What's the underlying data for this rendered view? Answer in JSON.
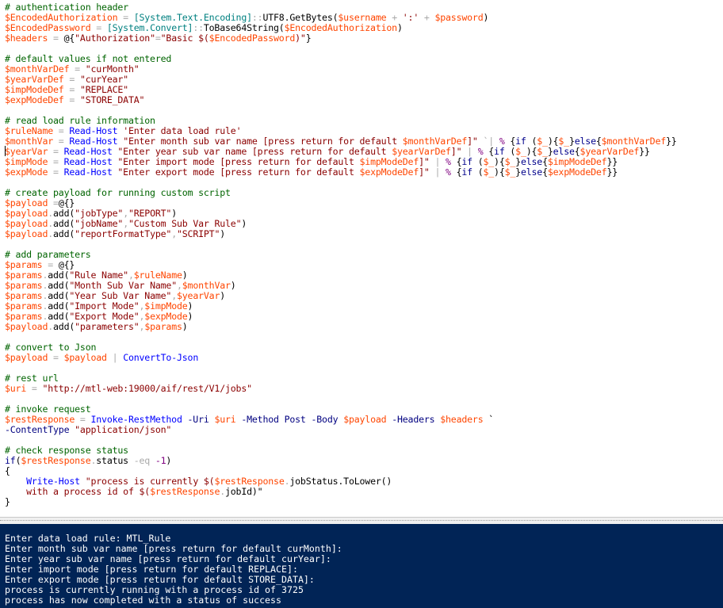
{
  "colors": {
    "editor_background": "#ffffff",
    "console_background": "#012456",
    "console_text": "#ffffff",
    "comment": "#006400",
    "variable": "#ff4500",
    "operator": "#a9a9a9",
    "string": "#8b0000",
    "command": "#0000ff",
    "type": "#008080",
    "parameter": "#000080"
  },
  "script": [
    [
      [
        "comment",
        "# authentication header"
      ]
    ],
    [
      [
        "var",
        "$EncodedAuthorization"
      ],
      [
        "op",
        " = "
      ],
      [
        "type",
        "[System.Text.Encoding]"
      ],
      [
        "op",
        "::"
      ],
      [
        "plain",
        "UTF8.GetBytes("
      ],
      [
        "var",
        "$username"
      ],
      [
        "op",
        " + "
      ],
      [
        "str",
        "':'"
      ],
      [
        "op",
        " + "
      ],
      [
        "var",
        "$password"
      ],
      [
        "plain",
        ")"
      ]
    ],
    [
      [
        "var",
        "$EncodedPassword"
      ],
      [
        "op",
        " = "
      ],
      [
        "type",
        "[System.Convert]"
      ],
      [
        "op",
        "::"
      ],
      [
        "plain",
        "ToBase64String("
      ],
      [
        "var",
        "$EncodedAuthorization"
      ],
      [
        "plain",
        ")"
      ]
    ],
    [
      [
        "var",
        "$headers"
      ],
      [
        "op",
        " = "
      ],
      [
        "plain",
        "@{"
      ],
      [
        "str",
        "\"Authorization\""
      ],
      [
        "op",
        "="
      ],
      [
        "str",
        "\"Basic $("
      ],
      [
        "var",
        "$EncodedPassword"
      ],
      [
        "str",
        ")\""
      ],
      [
        "plain",
        "}"
      ]
    ],
    [],
    [
      [
        "comment",
        "# default values if not entered"
      ]
    ],
    [
      [
        "var",
        "$monthVarDef"
      ],
      [
        "op",
        " = "
      ],
      [
        "str",
        "\"curMonth\""
      ]
    ],
    [
      [
        "var",
        "$yearVarDef"
      ],
      [
        "op",
        " = "
      ],
      [
        "str",
        "\"curYear\""
      ]
    ],
    [
      [
        "var",
        "$impModeDef"
      ],
      [
        "op",
        " = "
      ],
      [
        "str",
        "\"REPLACE\""
      ]
    ],
    [
      [
        "var",
        "$expModeDef"
      ],
      [
        "op",
        " = "
      ],
      [
        "str",
        "\"STORE_DATA\""
      ]
    ],
    [],
    [
      [
        "comment",
        "# read load rule information"
      ]
    ],
    [
      [
        "var",
        "$ruleName"
      ],
      [
        "op",
        " = "
      ],
      [
        "cmd",
        "Read-Host"
      ],
      [
        "plain",
        " "
      ],
      [
        "str",
        "'Enter data load rule'"
      ]
    ],
    [
      [
        "var",
        "$monthVar"
      ],
      [
        "op",
        " = "
      ],
      [
        "cmd",
        "Read-Host"
      ],
      [
        "plain",
        " "
      ],
      [
        "str",
        "\"Enter month sub var name [press return for default "
      ],
      [
        "var",
        "$monthVarDef"
      ],
      [
        "str",
        "]\""
      ],
      [
        "plain",
        " "
      ],
      [
        "op",
        "`|"
      ],
      [
        "plain",
        " "
      ],
      [
        "num",
        "%"
      ],
      [
        "plain",
        " {"
      ],
      [
        "kw",
        "if"
      ],
      [
        "plain",
        " ("
      ],
      [
        "var",
        "$_"
      ],
      [
        "plain",
        "){"
      ],
      [
        "var",
        "$_"
      ],
      [
        "plain",
        "}"
      ],
      [
        "kw",
        "else"
      ],
      [
        "plain",
        "{"
      ],
      [
        "var",
        "$monthVarDef"
      ],
      [
        "plain",
        "}}"
      ]
    ],
    [
      [
        "var",
        "$yearVar"
      ],
      [
        "op",
        " = "
      ],
      [
        "cmd",
        "Read-Host"
      ],
      [
        "plain",
        " "
      ],
      [
        "str",
        "\"Enter year sub var name [press return for default "
      ],
      [
        "var",
        "$yearVarDef"
      ],
      [
        "str",
        "]\""
      ],
      [
        "plain",
        " "
      ],
      [
        "op",
        "|"
      ],
      [
        "plain",
        " "
      ],
      [
        "num",
        "%"
      ],
      [
        "plain",
        " {"
      ],
      [
        "kw",
        "if"
      ],
      [
        "plain",
        " ("
      ],
      [
        "var",
        "$_"
      ],
      [
        "plain",
        "){"
      ],
      [
        "var",
        "$_"
      ],
      [
        "plain",
        "}"
      ],
      [
        "kw",
        "else"
      ],
      [
        "plain",
        "{"
      ],
      [
        "var",
        "$yearVarDef"
      ],
      [
        "plain",
        "}}"
      ]
    ],
    [
      [
        "var",
        "$impMode"
      ],
      [
        "op",
        " = "
      ],
      [
        "cmd",
        "Read-Host"
      ],
      [
        "plain",
        " "
      ],
      [
        "str",
        "\"Enter import mode [press return for default "
      ],
      [
        "var",
        "$impModeDef"
      ],
      [
        "str",
        "]\""
      ],
      [
        "plain",
        " "
      ],
      [
        "op",
        "|"
      ],
      [
        "plain",
        " "
      ],
      [
        "num",
        "%"
      ],
      [
        "plain",
        " {"
      ],
      [
        "kw",
        "if"
      ],
      [
        "plain",
        " ("
      ],
      [
        "var",
        "$_"
      ],
      [
        "plain",
        "){"
      ],
      [
        "var",
        "$_"
      ],
      [
        "plain",
        "}"
      ],
      [
        "kw",
        "else"
      ],
      [
        "plain",
        "{"
      ],
      [
        "var",
        "$impModeDef"
      ],
      [
        "plain",
        "}}"
      ]
    ],
    [
      [
        "var",
        "$expMode"
      ],
      [
        "op",
        " = "
      ],
      [
        "cmd",
        "Read-Host"
      ],
      [
        "plain",
        " "
      ],
      [
        "str",
        "\"Enter export mode [press return for default "
      ],
      [
        "var",
        "$expModeDef"
      ],
      [
        "str",
        "]\""
      ],
      [
        "plain",
        " "
      ],
      [
        "op",
        "|"
      ],
      [
        "plain",
        " "
      ],
      [
        "num",
        "%"
      ],
      [
        "plain",
        " {"
      ],
      [
        "kw",
        "if"
      ],
      [
        "plain",
        " ("
      ],
      [
        "var",
        "$_"
      ],
      [
        "plain",
        "){"
      ],
      [
        "var",
        "$_"
      ],
      [
        "plain",
        "}"
      ],
      [
        "kw",
        "else"
      ],
      [
        "plain",
        "{"
      ],
      [
        "var",
        "$expModeDef"
      ],
      [
        "plain",
        "}}"
      ]
    ],
    [],
    [
      [
        "comment",
        "# create payload for running custom script"
      ]
    ],
    [
      [
        "var",
        "$payload"
      ],
      [
        "op",
        " ="
      ],
      [
        "plain",
        "@{}"
      ]
    ],
    [
      [
        "var",
        "$payload"
      ],
      [
        "op",
        "."
      ],
      [
        "plain",
        "add("
      ],
      [
        "str",
        "\"jobType\""
      ],
      [
        "op",
        ","
      ],
      [
        "str",
        "\"REPORT\""
      ],
      [
        "plain",
        ")"
      ]
    ],
    [
      [
        "var",
        "$payload"
      ],
      [
        "op",
        "."
      ],
      [
        "plain",
        "add("
      ],
      [
        "str",
        "\"jobName\""
      ],
      [
        "op",
        ","
      ],
      [
        "str",
        "\"Custom Sub Var Rule\""
      ],
      [
        "plain",
        ")"
      ]
    ],
    [
      [
        "var",
        "$payload"
      ],
      [
        "op",
        "."
      ],
      [
        "plain",
        "add("
      ],
      [
        "str",
        "\"reportFormatType\""
      ],
      [
        "op",
        ","
      ],
      [
        "str",
        "\"SCRIPT\""
      ],
      [
        "plain",
        ")"
      ]
    ],
    [],
    [
      [
        "comment",
        "# add parameters"
      ]
    ],
    [
      [
        "var",
        "$params"
      ],
      [
        "op",
        " = "
      ],
      [
        "plain",
        "@{}"
      ]
    ],
    [
      [
        "var",
        "$params"
      ],
      [
        "op",
        "."
      ],
      [
        "plain",
        "add("
      ],
      [
        "str",
        "\"Rule Name\""
      ],
      [
        "op",
        ","
      ],
      [
        "var",
        "$ruleName"
      ],
      [
        "plain",
        ")"
      ]
    ],
    [
      [
        "var",
        "$params"
      ],
      [
        "op",
        "."
      ],
      [
        "plain",
        "add("
      ],
      [
        "str",
        "\"Month Sub Var Name\""
      ],
      [
        "op",
        ","
      ],
      [
        "var",
        "$monthVar"
      ],
      [
        "plain",
        ")"
      ]
    ],
    [
      [
        "var",
        "$params"
      ],
      [
        "op",
        "."
      ],
      [
        "plain",
        "add("
      ],
      [
        "str",
        "\"Year Sub Var Name\""
      ],
      [
        "op",
        ","
      ],
      [
        "var",
        "$yearVar"
      ],
      [
        "plain",
        ")"
      ]
    ],
    [
      [
        "var",
        "$params"
      ],
      [
        "op",
        "."
      ],
      [
        "plain",
        "add("
      ],
      [
        "str",
        "\"Import Mode\""
      ],
      [
        "op",
        ","
      ],
      [
        "var",
        "$impMode"
      ],
      [
        "plain",
        ")"
      ]
    ],
    [
      [
        "var",
        "$params"
      ],
      [
        "op",
        "."
      ],
      [
        "plain",
        "add("
      ],
      [
        "str",
        "\"Export Mode\""
      ],
      [
        "op",
        ","
      ],
      [
        "var",
        "$expMode"
      ],
      [
        "plain",
        ")"
      ]
    ],
    [
      [
        "var",
        "$payload"
      ],
      [
        "op",
        "."
      ],
      [
        "plain",
        "add("
      ],
      [
        "str",
        "\"parameters\""
      ],
      [
        "op",
        ","
      ],
      [
        "var",
        "$params"
      ],
      [
        "plain",
        ")"
      ]
    ],
    [],
    [
      [
        "comment",
        "# convert to Json"
      ]
    ],
    [
      [
        "var",
        "$payload"
      ],
      [
        "op",
        " = "
      ],
      [
        "var",
        "$payload"
      ],
      [
        "plain",
        " "
      ],
      [
        "op",
        "|"
      ],
      [
        "plain",
        " "
      ],
      [
        "cmd",
        "ConvertTo-Json"
      ]
    ],
    [],
    [
      [
        "comment",
        "# rest url"
      ]
    ],
    [
      [
        "var",
        "$uri"
      ],
      [
        "op",
        " = "
      ],
      [
        "str",
        "\"http://mtl-web:19000/aif/rest/V1/jobs\""
      ]
    ],
    [],
    [
      [
        "comment",
        "# invoke request"
      ]
    ],
    [
      [
        "var",
        "$restResponse"
      ],
      [
        "op",
        " = "
      ],
      [
        "cmd",
        "Invoke-RestMethod"
      ],
      [
        "plain",
        " "
      ],
      [
        "param",
        "-Uri"
      ],
      [
        "plain",
        " "
      ],
      [
        "var",
        "$uri"
      ],
      [
        "plain",
        " "
      ],
      [
        "param",
        "-Method"
      ],
      [
        "plain",
        " "
      ],
      [
        "attr",
        "Post"
      ],
      [
        "plain",
        " "
      ],
      [
        "param",
        "-Body"
      ],
      [
        "plain",
        " "
      ],
      [
        "var",
        "$payload"
      ],
      [
        "plain",
        " "
      ],
      [
        "param",
        "-Headers"
      ],
      [
        "plain",
        " "
      ],
      [
        "var",
        "$headers"
      ],
      [
        "plain",
        " `"
      ]
    ],
    [
      [
        "param",
        "-ContentType"
      ],
      [
        "plain",
        " "
      ],
      [
        "str",
        "\"application/json\""
      ]
    ],
    [],
    [
      [
        "comment",
        "# check response status"
      ]
    ],
    [
      [
        "kw",
        "if"
      ],
      [
        "plain",
        "("
      ],
      [
        "var",
        "$restResponse"
      ],
      [
        "op",
        "."
      ],
      [
        "plain",
        "status "
      ],
      [
        "op",
        "-eq"
      ],
      [
        "plain",
        " "
      ],
      [
        "num",
        "-1"
      ],
      [
        "plain",
        ")"
      ]
    ],
    [
      [
        "plain",
        "{"
      ]
    ],
    [
      [
        "plain",
        "    "
      ],
      [
        "cmd",
        "Write-Host"
      ],
      [
        "plain",
        " "
      ],
      [
        "str",
        "\"process is currently $("
      ],
      [
        "var",
        "$restResponse"
      ],
      [
        "op",
        "."
      ],
      [
        "plain",
        "jobStatus.ToLower()"
      ]
    ],
    [
      [
        "plain",
        "    "
      ],
      [
        "str",
        "with a process id of $("
      ],
      [
        "var",
        "$restResponse"
      ],
      [
        "op",
        "."
      ],
      [
        "plain",
        "jobId)\""
      ]
    ],
    [
      [
        "plain",
        "}"
      ]
    ]
  ],
  "console": {
    "lines": [
      "Enter data load rule: MTL_Rule",
      "Enter month sub var name [press return for default curMonth]:",
      "Enter year sub var name [press return for default curYear]:",
      "Enter import mode [press return for default REPLACE]:",
      "Enter export mode [press return for default STORE_DATA]:",
      "process is currently running with a process id of 3725",
      "process has now completed with a status of success"
    ]
  }
}
